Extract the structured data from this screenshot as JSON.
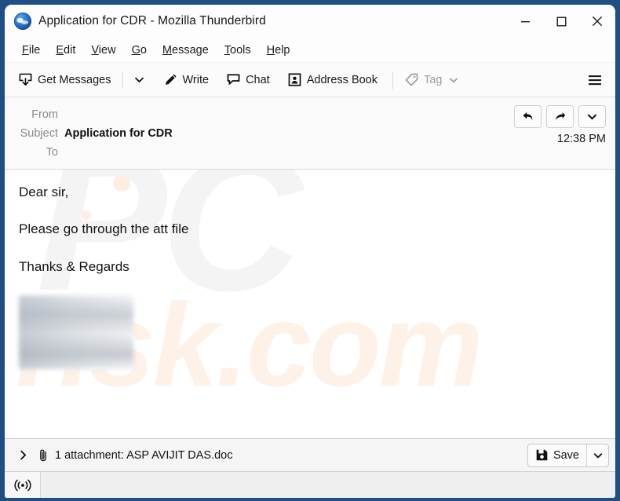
{
  "window": {
    "title": "Application for CDR - Mozilla Thunderbird",
    "app_icon": "thunderbird-icon",
    "frame_color": "#1f4e85",
    "controls": {
      "minimize": "Minimize",
      "maximize": "Maximize",
      "close": "Close"
    }
  },
  "menu_bar": {
    "items": [
      {
        "label": "File",
        "accesskey": "F"
      },
      {
        "label": "Edit",
        "accesskey": "E"
      },
      {
        "label": "View",
        "accesskey": "V"
      },
      {
        "label": "Go",
        "accesskey": "G"
      },
      {
        "label": "Message",
        "accesskey": "M"
      },
      {
        "label": "Tools",
        "accesskey": "T"
      },
      {
        "label": "Help",
        "accesskey": "H"
      }
    ]
  },
  "toolbar": {
    "get_messages_label": "Get Messages",
    "get_messages_icon": "download-inbox-icon",
    "get_messages_dropdown_icon": "chevron-down-icon",
    "write_label": "Write",
    "write_icon": "pencil-icon",
    "chat_label": "Chat",
    "chat_icon": "speech-bubble-icon",
    "address_book_label": "Address Book",
    "address_book_icon": "contact-card-icon",
    "tag_label": "Tag",
    "tag_icon": "tag-icon",
    "tag_dropdown_icon": "chevron-down-icon",
    "tag_disabled": true,
    "app_menu_icon": "hamburger-menu-icon"
  },
  "message_header": {
    "from_label": "From",
    "from_value": "",
    "subject_label": "Subject",
    "subject_value": "Application for CDR",
    "to_label": "To",
    "to_value": "",
    "time": "12:38 PM",
    "actions": {
      "reply_icon": "reply-arrow-icon",
      "forward_icon": "forward-arrow-icon",
      "more_icon": "chevron-down-icon"
    }
  },
  "message_body": {
    "lines": [
      "Dear sir,",
      "Please go through the att file",
      "Thanks & Regards"
    ],
    "signature_image": "blurred-signature-block",
    "watermark_primary": "PC",
    "watermark_secondary": "risk.com"
  },
  "attachment_bar": {
    "expander_icon": "chevron-right-icon",
    "paperclip_icon": "paperclip-icon",
    "label": "1 attachment: ASP AVIJIT DAS.doc",
    "count": 1,
    "filename": "ASP AVIJIT DAS.doc",
    "save_label": "Save",
    "save_icon": "save-disk-icon",
    "save_dropdown_icon": "chevron-down-icon"
  },
  "status_bar": {
    "connection_icon": "broadcast-signal-icon",
    "message": ""
  }
}
